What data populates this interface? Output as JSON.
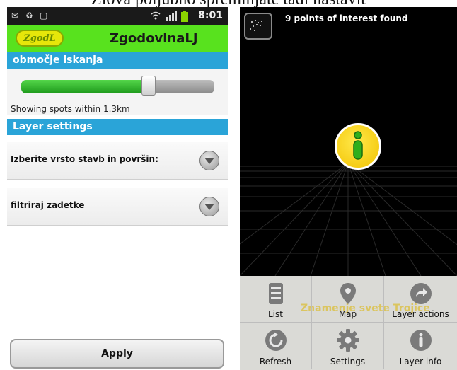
{
  "doc_caption": "Zlova poljubno spreminjate tadi nastavit",
  "left": {
    "statusbar": {
      "time": "8:01"
    },
    "app": {
      "logo": "ZgodL",
      "title": "ZgodovinaLJ"
    },
    "section_search": "območje iskanja",
    "slider": {
      "caption": "Showing spots within 1.3km",
      "value_fraction": 0.66
    },
    "section_layer": "Layer settings",
    "rows": [
      {
        "label": "Izberite vrsto stavb in površin:"
      },
      {
        "label": "filtriraj zadetke"
      }
    ],
    "apply_label": "Apply"
  },
  "right": {
    "poi_count": "9 points of interest found",
    "menu": [
      {
        "label": "List",
        "icon": "list-icon"
      },
      {
        "label": "Map",
        "icon": "map-pin-icon"
      },
      {
        "label": "Layer actions",
        "icon": "share-arrow-icon"
      },
      {
        "label": "Refresh",
        "icon": "refresh-icon"
      },
      {
        "label": "Settings",
        "icon": "gear-icon"
      },
      {
        "label": "Layer info",
        "icon": "info-icon"
      }
    ],
    "ghost_text": "Znamenje svete Trojice"
  }
}
